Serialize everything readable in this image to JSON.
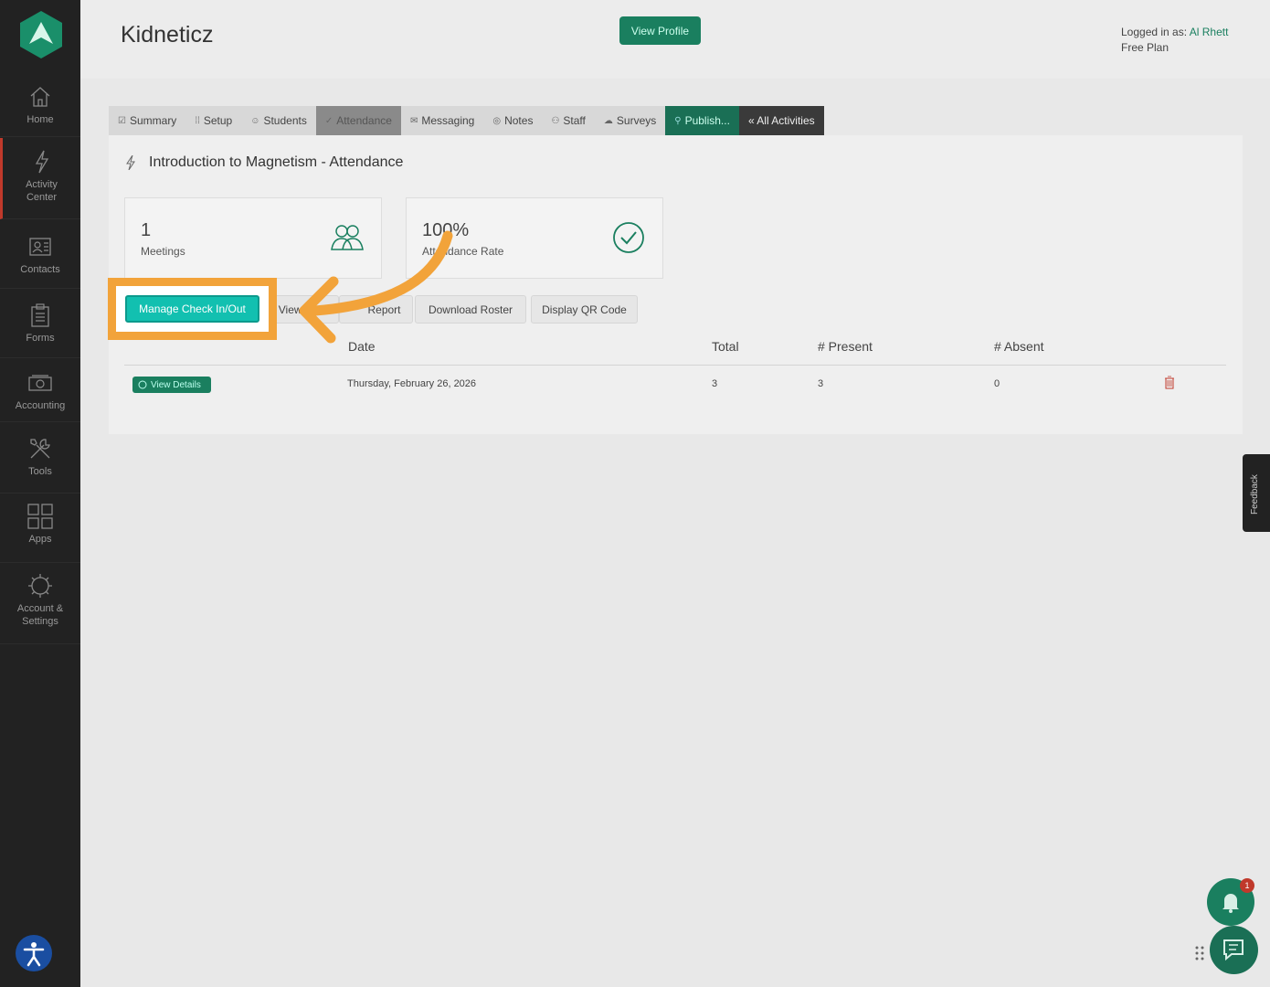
{
  "sidebar": {
    "items": [
      {
        "label": "Home",
        "icon": "home-icon"
      },
      {
        "label": "Activity",
        "label2": "Center",
        "icon": "lightning-icon"
      },
      {
        "label": "Contacts",
        "icon": "contacts-icon"
      },
      {
        "label": "Forms",
        "icon": "clipboard-icon"
      },
      {
        "label": "Accounting",
        "icon": "money-icon"
      },
      {
        "label": "Tools",
        "icon": "tools-icon"
      },
      {
        "label": "Apps",
        "icon": "apps-grid-icon"
      },
      {
        "label": "Account &",
        "label2": "Settings",
        "icon": "gear-icon"
      }
    ]
  },
  "header": {
    "brand": "Kidneticz",
    "view_profile": "View Profile",
    "logged_in_label": "Logged in as: ",
    "user_name": "Al Rhett",
    "plan": "Free Plan"
  },
  "tabs": [
    {
      "label": "Summary",
      "glyph": "☑"
    },
    {
      "label": "Setup",
      "glyph": "⁞⁞"
    },
    {
      "label": "Students",
      "glyph": "☺"
    },
    {
      "label": "Attendance",
      "glyph": "✓"
    },
    {
      "label": "Messaging",
      "glyph": "✉"
    },
    {
      "label": "Notes",
      "glyph": "◎"
    },
    {
      "label": "Staff",
      "glyph": "⚇"
    },
    {
      "label": "Surveys",
      "glyph": "☁"
    },
    {
      "label": "Publish...",
      "glyph": "⚲"
    },
    {
      "label": "« All Activities",
      "glyph": ""
    }
  ],
  "panel": {
    "title": "Introduction to Magnetism - Attendance",
    "stats": [
      {
        "value": "1",
        "label": "Meetings"
      },
      {
        "value": "100%",
        "label": "Attendance Rate"
      }
    ],
    "buttons": {
      "manage": "Manage Check In/Out",
      "view_partial": "View",
      "report_partial": "Report",
      "download": "Download Roster",
      "qr": "Display QR Code"
    },
    "table": {
      "headers": [
        "Date",
        "Total",
        "# Present",
        "# Absent"
      ],
      "rows": [
        {
          "action": "View Details",
          "date": "Thursday, February 26, 2026",
          "total": "3",
          "present": "3",
          "absent": "0"
        }
      ]
    }
  },
  "feedback": "Feedback",
  "notifications": {
    "count": "1"
  },
  "colors": {
    "brand_green": "#1a7f5f",
    "highlight_orange": "#f2a33a",
    "teal_button": "#12c0b0"
  }
}
